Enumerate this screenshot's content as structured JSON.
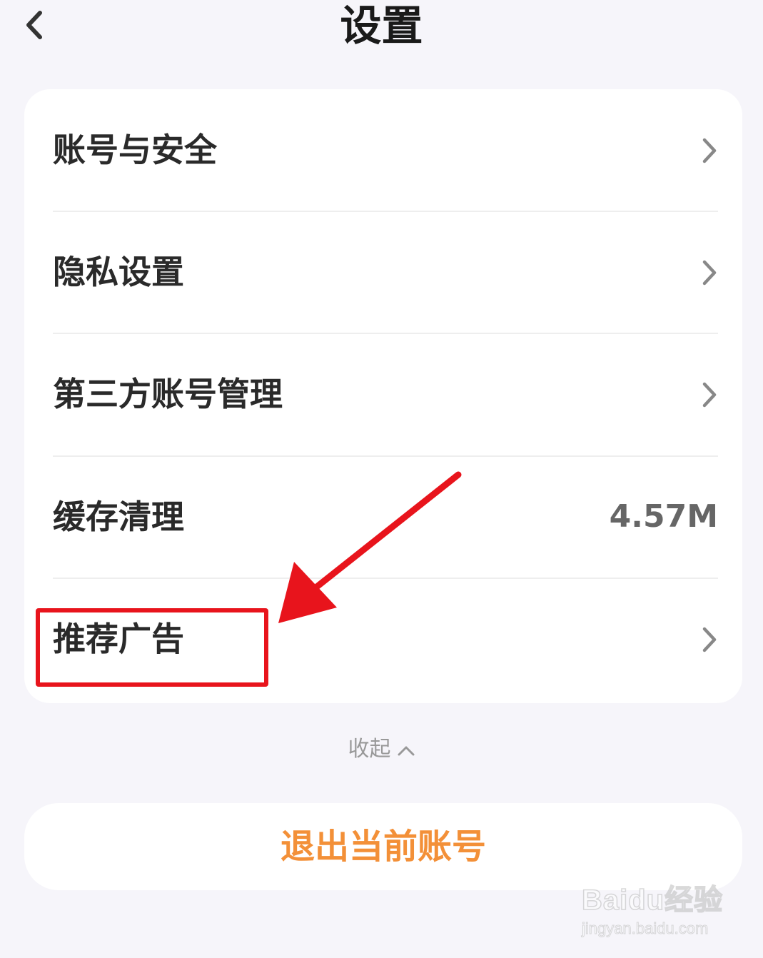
{
  "header": {
    "title": "设置"
  },
  "settings": {
    "items": [
      {
        "label": "账号与安全",
        "icon": "chevron-right-icon"
      },
      {
        "label": "隐私设置",
        "icon": "chevron-right-icon"
      },
      {
        "label": "第三方账号管理",
        "icon": "chevron-right-icon"
      },
      {
        "label": "缓存清理",
        "value": "4.57M"
      },
      {
        "label": "推荐广告",
        "icon": "chevron-right-icon"
      }
    ]
  },
  "collapse": {
    "label": "收起",
    "icon": "chevron-up-icon"
  },
  "logout": {
    "label": "退出当前账号"
  },
  "annotation": {
    "color": "#e8141c"
  },
  "watermark": {
    "brand": "Baidu经验",
    "url": "jingyan.baidu.com"
  },
  "colors": {
    "accent": "#f39038",
    "background": "#f6f5fa",
    "card": "#ffffff"
  }
}
